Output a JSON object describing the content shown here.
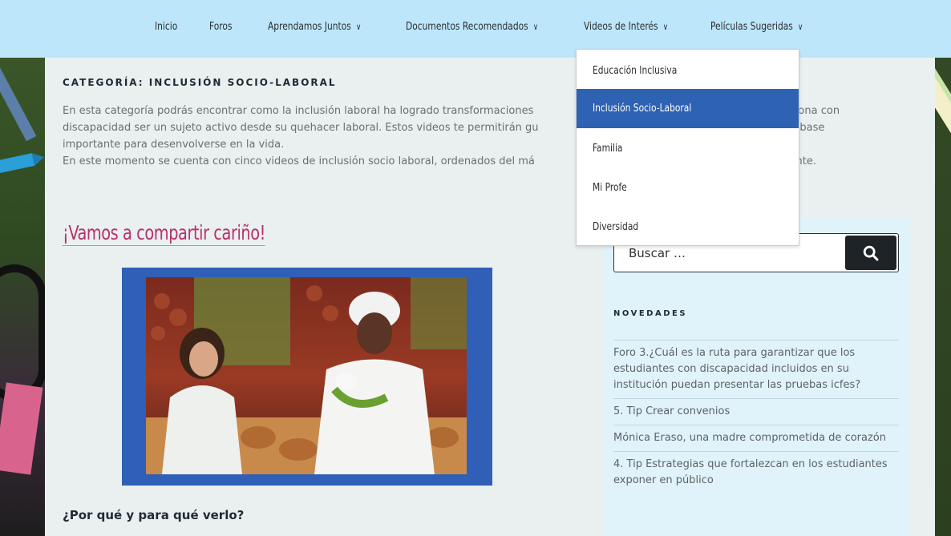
{
  "nav": {
    "items": [
      {
        "label": "Inicio",
        "has_dropdown": false
      },
      {
        "label": "Foros",
        "has_dropdown": false
      },
      {
        "label": "Aprendamos Juntos",
        "has_dropdown": true
      },
      {
        "label": "Documentos Recomendados",
        "has_dropdown": true
      },
      {
        "label": "Videos de Interés",
        "has_dropdown": true
      },
      {
        "label": "Películas Sugeridas",
        "has_dropdown": true
      }
    ],
    "dropdown": {
      "items": [
        {
          "label": "Educación Inclusiva"
        },
        {
          "label": "Inclusión Socio-Laboral",
          "active": true
        },
        {
          "label": "Familia"
        },
        {
          "label": "Mi Profe"
        },
        {
          "label": "Diversidad"
        }
      ]
    }
  },
  "category": {
    "title": "CATEGORÍA: INCLUSIÓN SOCIO-LABORAL",
    "intro_lines": [
      "En esta categoría podrás encontrar como la inclusión laboral ha logrado transformaciones",
      "la persona con",
      "discapacidad ser un sujeto activo desde su quehacer laboral. Estos videos te permitirán gu",
      "como base",
      "importante para desenvolverse en la vida.",
      "En este momento se cuenta con cinco videos de inclusión socio laboral, ordenados del má",
      "cendente."
    ]
  },
  "post": {
    "title": "¡Vamos a compartir cariño!",
    "why_heading": "¿Por qué y para qué verlo?"
  },
  "sidebar": {
    "search_placeholder": "Buscar …",
    "news_heading": "NOVEDADES",
    "news": [
      "Foro 3.¿Cuál es la ruta para garantizar que los estudiantes con discapacidad incluidos en su institución puedan presentar las pruebas icfes?",
      "5. Tip Crear convenios",
      "Mónica Eraso, una madre comprometida de corazón",
      "4. Tip Estrategias que fortalezcan en los estudiantes exponer en público"
    ]
  },
  "colors": {
    "nav_bg": "#bde6fb",
    "active_dropdown": "#2e62b3",
    "post_title": "#b7326b",
    "video_frame": "#2f5fb7",
    "sidebar_bg": "#e0f3fb"
  },
  "icons": {
    "search": "search-icon",
    "chevron": "chevron-down-icon"
  }
}
